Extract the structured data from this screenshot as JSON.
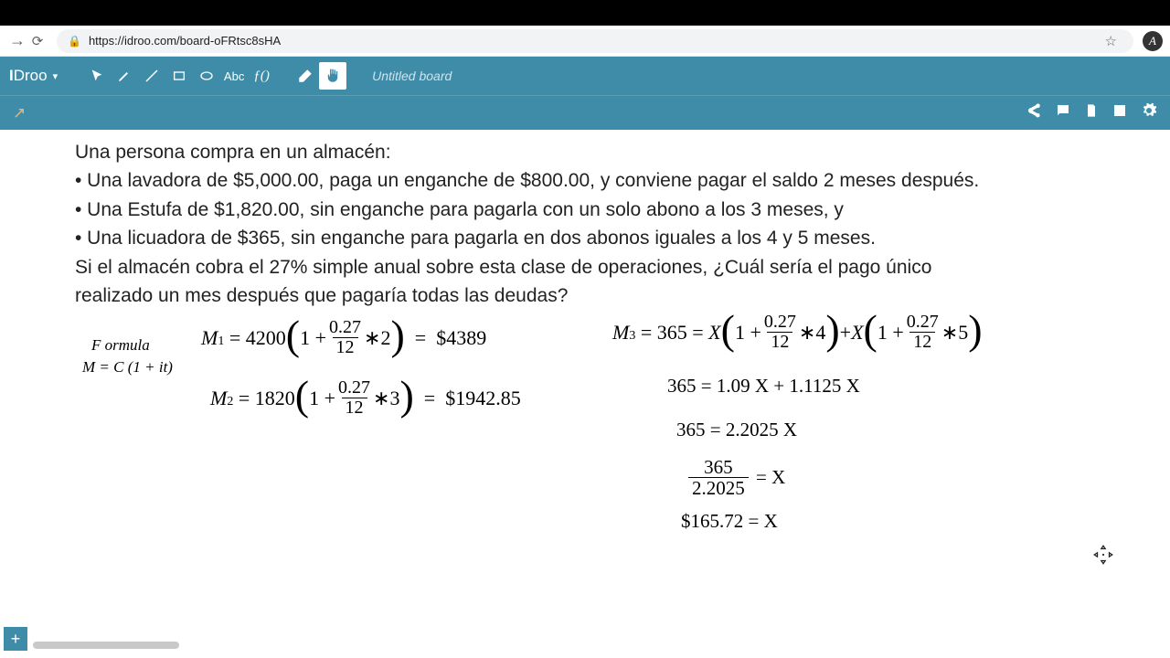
{
  "browser": {
    "url": "https://idroo.com/board-oFRtsc8sHA",
    "avatar_letter": "A"
  },
  "app": {
    "logo_prefix": "I",
    "logo_main": "Droo",
    "board_title": "Untitled board",
    "abc_label": "Abc",
    "fx_label": "ƒ()"
  },
  "problem": {
    "l1": "Una persona compra en un almacén:",
    "l2": "• Una lavadora de $5,000.00, paga un enganche de $800.00, y conviene pagar el saldo 2 meses después.",
    "l3": "• Una Estufa de $1,820.00, sin enganche para pagarla con un solo abono a los 3 meses, y",
    "l4": "• Una licuadora de $365, sin enganche para pagarla en dos abonos iguales a los 4 y 5 meses.",
    "l5": "Si el almacén cobra el 27% simple anual sobre esta clase de operaciones, ¿Cuál sería el pago único",
    "l6": "realizado un mes después que pagaría todas las deudas?"
  },
  "formula": {
    "label": "F ormula",
    "eq": "M = C (1 + it)"
  },
  "m1": {
    "lhs": "M",
    "sub": "1",
    "c": "4200",
    "rate": "0.27",
    "per": "12",
    "t": "2",
    "res": "$4389"
  },
  "m2": {
    "lhs": "M",
    "sub": "2",
    "c": "1820",
    "rate": "0.27",
    "per": "12",
    "t": "3",
    "res": "$1942.85"
  },
  "m3": {
    "lhs": "M",
    "sub": "3",
    "val": "365",
    "rate": "0.27",
    "per": "12",
    "t1": "4",
    "t2": "5"
  },
  "steps": {
    "s1": "365 = 1.09 X + 1.1125 X",
    "s2": "365 = 2.2025 X",
    "s3_num": "365",
    "s3_den": "2.2025",
    "s3_rhs": "= X",
    "s4": "$165.72  =  X"
  },
  "add_tab": "+"
}
